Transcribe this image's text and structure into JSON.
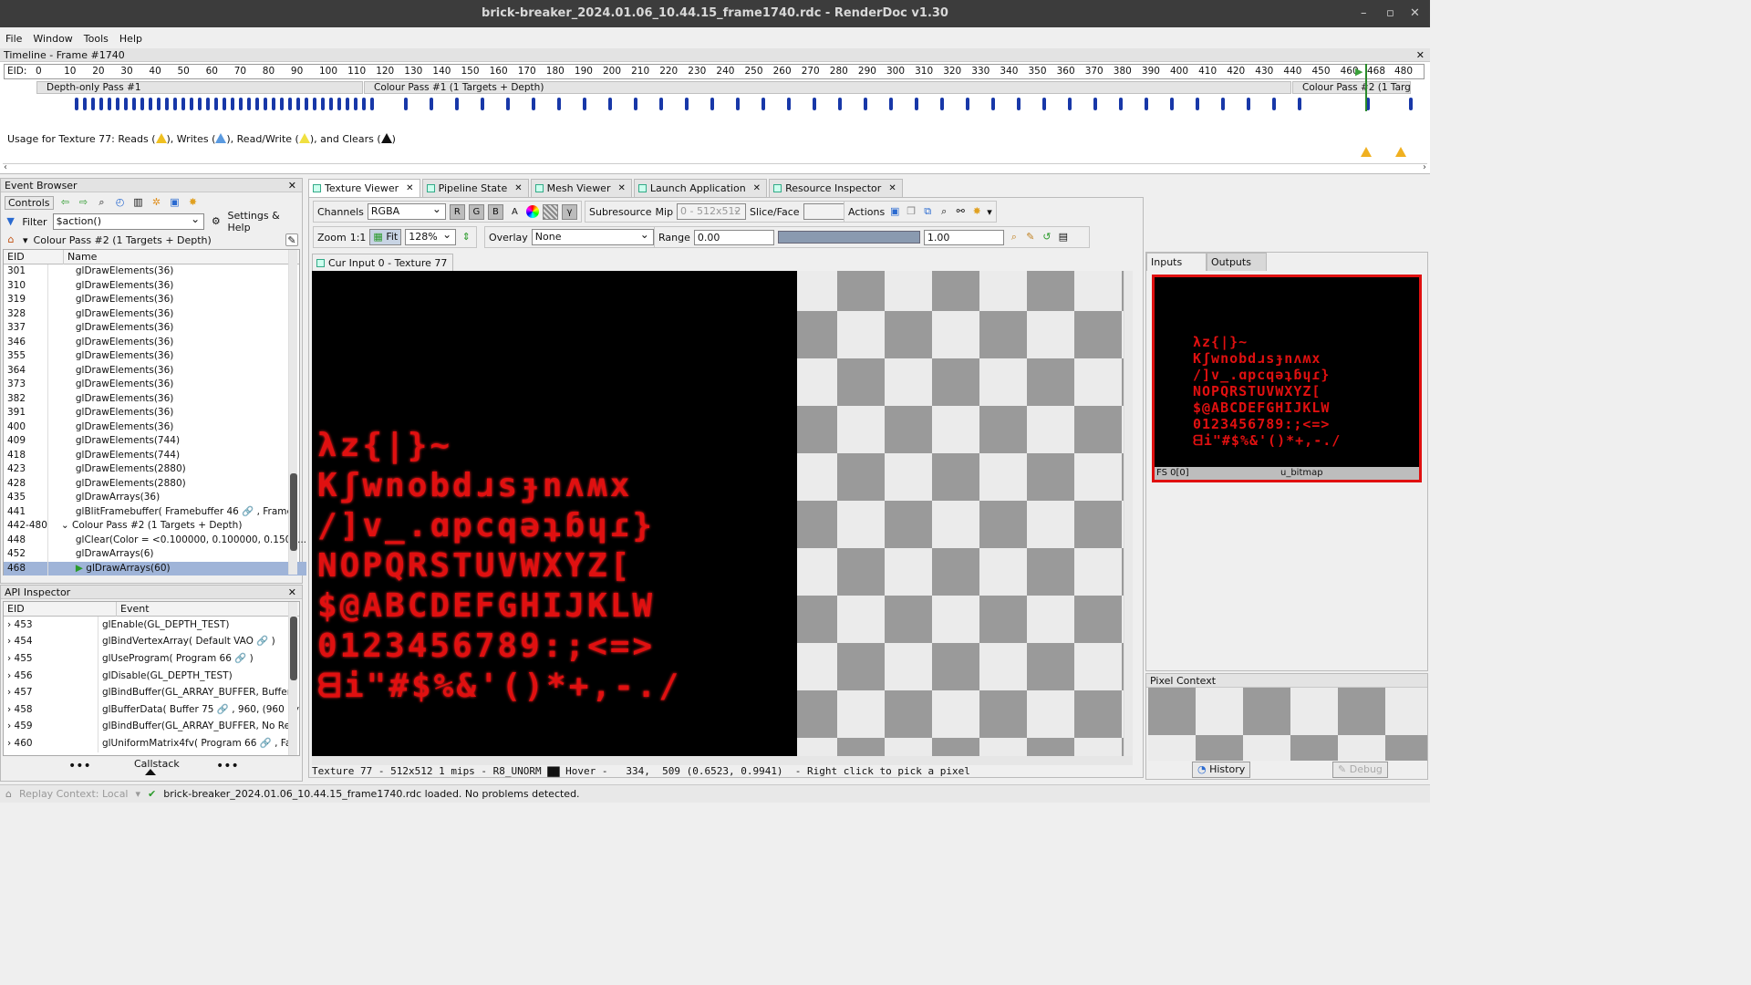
{
  "window": {
    "title": "brick-breaker_2024.01.06_10.44.15_frame1740.rdc - RenderDoc v1.30"
  },
  "menu": [
    "File",
    "Window",
    "Tools",
    "Help"
  ],
  "timeline": {
    "title": "Timeline - Frame #1740",
    "eid_label": "EID:",
    "ticks": [
      "0",
      "10",
      "20",
      "30",
      "40",
      "50",
      "60",
      "70",
      "80",
      "90",
      "100",
      "110",
      "120",
      "130",
      "140",
      "150",
      "160",
      "170",
      "180",
      "190",
      "200",
      "210",
      "220",
      "230",
      "240",
      "250",
      "260",
      "270",
      "280",
      "290",
      "300",
      "310",
      "320",
      "330",
      "340",
      "350",
      "360",
      "370",
      "380",
      "390",
      "400",
      "410",
      "420",
      "430",
      "440",
      "450",
      "460",
      "468",
      "480"
    ],
    "passes": [
      "Depth-only Pass #1",
      "Colour Pass #1 (1 Targets + Depth)",
      "Colour Pass #2 (1 Targ..."
    ],
    "usage_prefix": "Usage for Texture 77: Reads (",
    "usage_writes": "), Writes (",
    "usage_rw": "), Read/Write (",
    "usage_clears": "), and Clears (",
    "usage_end": ")"
  },
  "event_browser": {
    "title": "Event Browser",
    "controls_label": "Controls",
    "filter_label": "Filter",
    "filter_value": "$action()",
    "settings_label": "Settings & Help",
    "current_pass": "Colour Pass #2 (1 Targets + Depth)",
    "columns": [
      "EID",
      "Name"
    ],
    "rows": [
      {
        "eid": "301",
        "name": "glDrawElements(36)"
      },
      {
        "eid": "310",
        "name": "glDrawElements(36)"
      },
      {
        "eid": "319",
        "name": "glDrawElements(36)"
      },
      {
        "eid": "328",
        "name": "glDrawElements(36)"
      },
      {
        "eid": "337",
        "name": "glDrawElements(36)"
      },
      {
        "eid": "346",
        "name": "glDrawElements(36)"
      },
      {
        "eid": "355",
        "name": "glDrawElements(36)"
      },
      {
        "eid": "364",
        "name": "glDrawElements(36)"
      },
      {
        "eid": "373",
        "name": "glDrawElements(36)"
      },
      {
        "eid": "382",
        "name": "glDrawElements(36)"
      },
      {
        "eid": "391",
        "name": "glDrawElements(36)"
      },
      {
        "eid": "400",
        "name": "glDrawElements(36)"
      },
      {
        "eid": "409",
        "name": "glDrawElements(744)"
      },
      {
        "eid": "418",
        "name": "glDrawElements(744)"
      },
      {
        "eid": "423",
        "name": "glDrawElements(2880)"
      },
      {
        "eid": "428",
        "name": "glDrawElements(2880)"
      },
      {
        "eid": "435",
        "name": "glDrawArrays(36)"
      },
      {
        "eid": "441",
        "name": "glBlitFramebuffer( Framebuffer 46 🔗 , Frame"
      },
      {
        "eid": "442-480",
        "name": "⌄ Colour Pass #2 (1 Targets + Depth)"
      },
      {
        "eid": "448",
        "name": "glClear(Color = <0.100000, 0.100000, 0.1500..."
      },
      {
        "eid": "452",
        "name": "glDrawArrays(6)"
      },
      {
        "eid": "468",
        "name": "glDrawArrays(60)"
      }
    ]
  },
  "api_inspector": {
    "title": "API Inspector",
    "columns": [
      "EID",
      "Event"
    ],
    "rows": [
      {
        "eid": "453",
        "event": "glEnable(GL_DEPTH_TEST)"
      },
      {
        "eid": "454",
        "event": "glBindVertexArray( Default VAO 🔗 )"
      },
      {
        "eid": "455",
        "event": "glUseProgram( Program 66 🔗 )"
      },
      {
        "eid": "456",
        "event": "glDisable(GL_DEPTH_TEST)"
      },
      {
        "eid": "457",
        "event": "glBindBuffer(GL_ARRAY_BUFFER,  Buffer"
      },
      {
        "eid": "458",
        "event": "glBufferData( Buffer 75 🔗 , 960, (960 by"
      },
      {
        "eid": "459",
        "event": "glBindBuffer(GL_ARRAY_BUFFER,  No Res"
      },
      {
        "eid": "460",
        "event": "glUniformMatrix4fv( Program 66 🔗 , Fal"
      }
    ],
    "callstack": "Callstack"
  },
  "tabs": [
    "Texture Viewer",
    "Pipeline State",
    "Mesh Viewer",
    "Launch Application",
    "Resource Inspector"
  ],
  "texture_viewer": {
    "channels_label": "Channels",
    "channels_value": "RGBA",
    "channel_buttons": [
      "R",
      "G",
      "B",
      "A"
    ],
    "subresource_label": "Subresource",
    "mip_label": "Mip",
    "mip_value": "0 - 512x512",
    "slice_label": "Slice/Face",
    "actions_label": "Actions",
    "zoom_label": "Zoom",
    "zoom_1to1": "1:1",
    "fit_label": "Fit",
    "zoom_value": "128%",
    "overlay_label": "Overlay",
    "overlay_value": "None",
    "range_label": "Range",
    "range_min": "0.00",
    "range_max": "1.00",
    "input_tab": "Cur Input 0 - Texture 77",
    "glyph_lines": [
      "λz{|}~",
      "Kʃwnobdɹsɟnʌʍx",
      "/]v_.ɑpcqǝʇɓɥɾ}",
      "NOPQRSTUVWXYZ[",
      "$@ABCDEFGHIJKLW",
      "0123456789:;<=>",
      "ᗺi\"#$%&'()*+,-./"
    ],
    "status": "Texture 77 - 512x512 1 mips - R8_UNORM ▇▇ Hover -   334,  509 (0.6523, 0.9941)  - Right click to pick a pixel"
  },
  "inputs_panel": {
    "tabs": [
      "Inputs",
      "Outputs"
    ],
    "thumb_slot": "FS 0[0]",
    "thumb_name": "u_bitmap",
    "thumb_glyphs": [
      "λz{|}~",
      "Kʃwnobdɹsɟnʌʍx",
      "/]v_.ɑpcqǝʇɓɥɾ}",
      "NOPQRSTUVWXYZ[",
      "$@ABCDEFGHIJKLW",
      "0123456789:;<=>",
      "ᗺi\"#$%&'()*+,-./"
    ]
  },
  "pixel_context": {
    "title": "Pixel Context",
    "history_label": "History",
    "debug_label": "Debug"
  },
  "statusbar": {
    "replay_context": "Replay Context: Local",
    "message": "brick-breaker_2024.01.06_10.44.15_frame1740.rdc loaded. No problems detected."
  },
  "colors": {
    "accent_red": "#e01010",
    "marker_blue": "#1838a8",
    "selection": "#9fb4d8"
  }
}
